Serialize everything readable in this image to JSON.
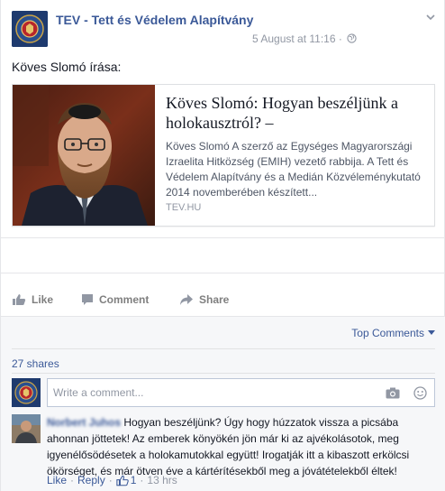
{
  "post": {
    "page_name": "TEV - Tett és Védelem Alapítvány",
    "timestamp": "5 August at 11:16",
    "separator": "·",
    "privacy_icon": "globe-icon",
    "menu_icon": "chevron-down-icon",
    "text": "Köves Slomó írása:"
  },
  "link_card": {
    "title": "Köves Slomó: Hogyan beszéljünk a holokausztról? –",
    "description": "Köves Slomó A szerző az Egységes Magyarországi Izraelita Hitközség (EMIH) vezető rabbija. A Tett és Védelem Alapítvány és a Medián Közvéleménykutató 2014 novemberében készített...",
    "domain": "TEV.HU"
  },
  "actions": {
    "like": "Like",
    "comment": "Comment",
    "share": "Share"
  },
  "ufi": {
    "sort_label": "Top Comments",
    "shares": "27 shares",
    "comment_placeholder": "Write a comment...",
    "comment": {
      "author": "Norbert Juhos",
      "text": " Hogyan beszéljünk? Úgy hogy húzzatok vissza a picsába ahonnan jöttetek! Az emberek könyökén jön már ki az ajvékolásotok, meg igyenélősödésetek a holokamutokkal együtt! Irogatják itt a kibaszott erkölcsi ökörséget, és már ötven éve a kártérítésekből meg a jóvátételekből éltek!",
      "like_label": "Like",
      "reply_label": "Reply",
      "likes": "1",
      "age": "13 hrs",
      "dot": "·"
    }
  },
  "colors": {
    "link_blue": "#3b5998",
    "meta_gray": "#9197a3",
    "tev_navy": "#1e3a6e",
    "tev_red": "#b8262b"
  }
}
